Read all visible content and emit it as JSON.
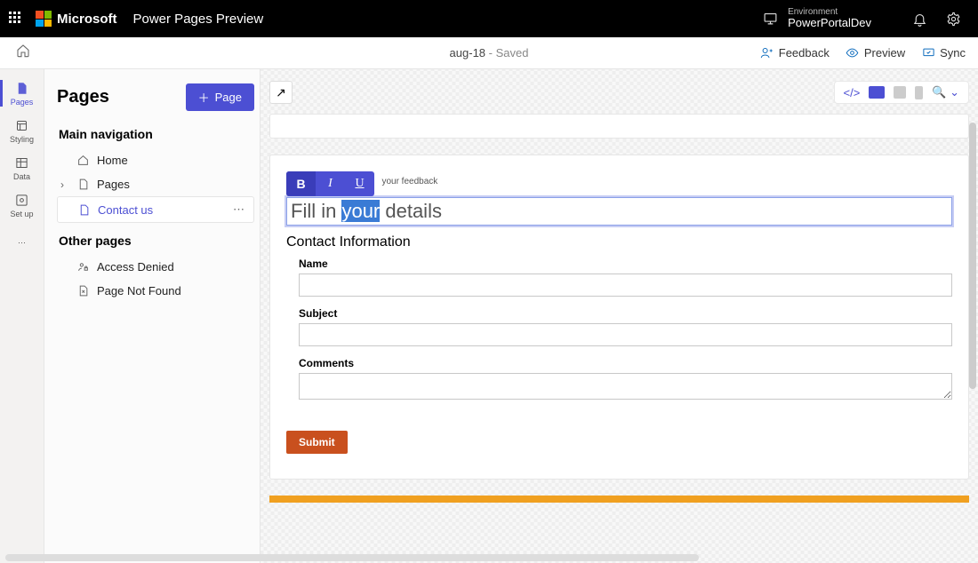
{
  "topbar": {
    "brand": "Microsoft",
    "app": "Power Pages Preview",
    "env_label": "Environment",
    "env_name": "PowerPortalDev"
  },
  "subbar": {
    "doc_name": "aug-18",
    "status": " - Saved",
    "feedback": "Feedback",
    "preview": "Preview",
    "sync": "Sync"
  },
  "rail": {
    "items": [
      {
        "label": "Pages"
      },
      {
        "label": "Styling"
      },
      {
        "label": "Data"
      },
      {
        "label": "Set up"
      }
    ]
  },
  "side": {
    "title": "Pages",
    "add_button": "Page",
    "section_main": "Main navigation",
    "section_other": "Other pages",
    "items_main": [
      {
        "label": "Home"
      },
      {
        "label": "Pages"
      },
      {
        "label": "Contact us"
      }
    ],
    "items_other": [
      {
        "label": "Access Denied"
      },
      {
        "label": "Page Not Found"
      }
    ]
  },
  "editor": {
    "crumb": "your feedback",
    "heading_pre": "Fill in ",
    "heading_sel": "your",
    "heading_post": " details",
    "section": "Contact Information",
    "fields": {
      "name": "Name",
      "subject": "Subject",
      "comments": "Comments"
    },
    "submit": "Submit",
    "fmt": {
      "bold": "B",
      "italic": "I",
      "underline": "U"
    },
    "tb_code": "</>"
  }
}
